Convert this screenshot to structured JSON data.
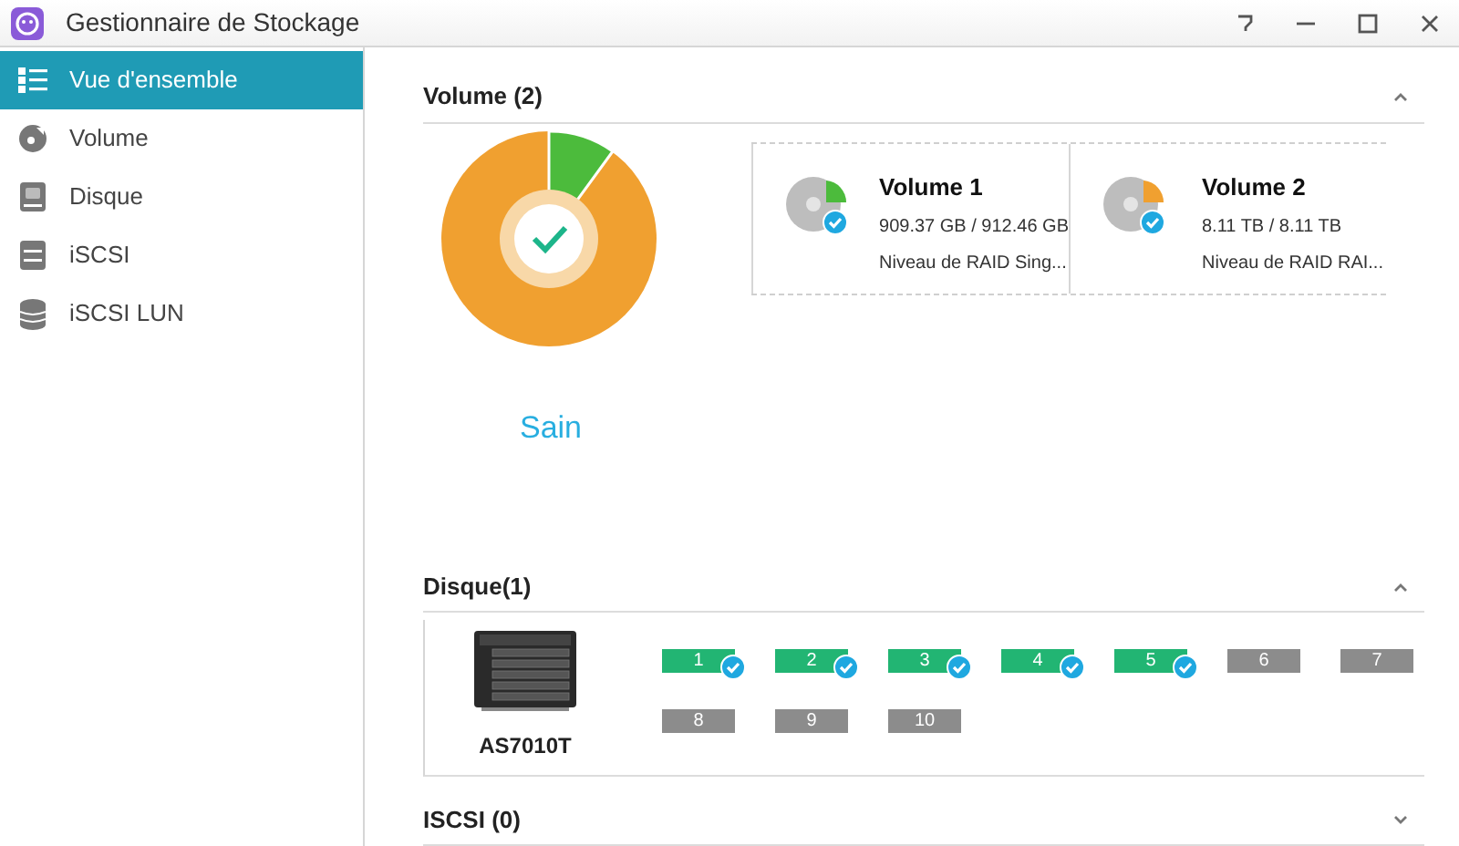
{
  "window": {
    "title": "Gestionnaire de Stockage"
  },
  "sidebar": {
    "items": [
      {
        "label": "Vue d'ensemble",
        "selected": true
      },
      {
        "label": "Volume",
        "selected": false
      },
      {
        "label": "Disque",
        "selected": false
      },
      {
        "label": "iSCSI",
        "selected": false
      },
      {
        "label": "iSCSI LUN",
        "selected": false
      }
    ]
  },
  "volume_section": {
    "title": "Volume (2)",
    "expanded": true,
    "status": "Sain",
    "volumes": [
      {
        "name": "Volume 1",
        "usage": "909.37 GB / 912.46 GB",
        "raid": "Niveau de RAID Sing...",
        "color": "#4cbb3c"
      },
      {
        "name": "Volume 2",
        "usage": "8.11 TB / 8.11 TB",
        "raid": "Niveau de RAID RAI...",
        "color": "#f0a030"
      }
    ]
  },
  "disk_section": {
    "title": "Disque(1)",
    "expanded": true,
    "device": "AS7010T",
    "bays": [
      {
        "label": "1",
        "kind": "ok"
      },
      {
        "label": "2",
        "kind": "ok"
      },
      {
        "label": "3",
        "kind": "ok"
      },
      {
        "label": "4",
        "kind": "ok"
      },
      {
        "label": "5",
        "kind": "ok"
      },
      {
        "label": "6",
        "kind": "empty"
      },
      {
        "label": "7",
        "kind": "empty"
      },
      {
        "label": "8",
        "kind": "empty"
      },
      {
        "label": "9",
        "kind": "empty"
      },
      {
        "label": "10",
        "kind": "empty"
      }
    ]
  },
  "iscsi_section": {
    "title": "ISCSI (0)",
    "expanded": false
  }
}
